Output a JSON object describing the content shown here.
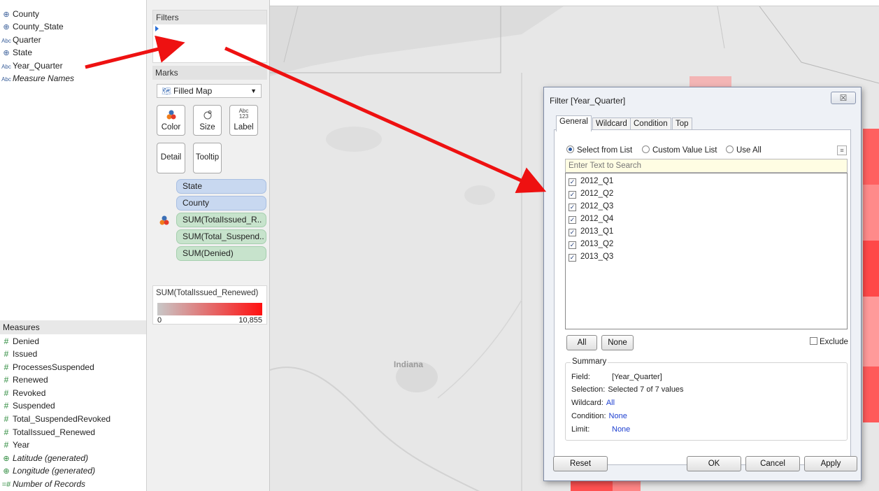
{
  "data_pane": {
    "dimensions": [
      {
        "icon": "globe-icon",
        "label": "County"
      },
      {
        "icon": "globe-icon",
        "label": "County_State"
      },
      {
        "icon": "abc-icon",
        "label": "Quarter"
      },
      {
        "icon": "globe-icon",
        "label": "State"
      },
      {
        "icon": "abc-icon",
        "label": "Year_Quarter"
      },
      {
        "icon": "abc-icon",
        "label": "Measure Names"
      }
    ],
    "measures_header": "Measures",
    "measures": [
      "Denied",
      "Issued",
      "ProcessesSuspended",
      "Renewed",
      "Revoked",
      "Suspended",
      "Total_SuspendedRevoked",
      "TotalIssued_Renewed",
      "Year",
      "Latitude (generated)",
      "Longitude (generated)",
      "Number of Records"
    ],
    "icon_glyphs": {
      "abc": "Abc",
      "hash": "#",
      "globe": "⊕",
      "calc_hash": "=#"
    }
  },
  "filters_card": {
    "title": "Filters"
  },
  "marks_card": {
    "title": "Marks",
    "mark_type": "Filled Map",
    "mark_type_icon": "filled-map-icon",
    "buttons": {
      "color": "Color",
      "size": "Size",
      "label": "Label",
      "detail": "Detail",
      "tooltip": "Tooltip"
    },
    "label_icon_text": "Abc\n123",
    "pills": [
      "State",
      "County",
      "SUM(TotalIssued_R..",
      "SUM(Total_Suspend..",
      "SUM(Denied)"
    ]
  },
  "legend": {
    "title": "SUM(TotalIssued_Renewed)",
    "min": "0",
    "max": "10,855",
    "colors": {
      "low": "#c8c8c8",
      "high": "#ff1010"
    }
  },
  "map": {
    "label": "Indiana"
  },
  "dialog": {
    "title": "Filter [Year_Quarter]",
    "close_glyph": "☒",
    "tabs": [
      "General",
      "Wildcard",
      "Condition",
      "Top"
    ],
    "radio": {
      "select_from_list": "Select from List",
      "custom_value_list": "Custom Value List",
      "use_all": "Use All",
      "selected": "Select from List"
    },
    "search_placeholder": "Enter Text to Search",
    "values": [
      "2012_Q1",
      "2012_Q2",
      "2012_Q3",
      "2012_Q4",
      "2013_Q1",
      "2013_Q2",
      "2013_Q3"
    ],
    "all_label": "All",
    "none_label": "None",
    "exclude_label": "Exclude",
    "summary": {
      "title": "Summary",
      "field_key": "Field:",
      "field_val": "[Year_Quarter]",
      "selection_key": "Selection:",
      "selection_val": "Selected 7 of 7 values",
      "wildcard_key": "Wildcard:",
      "wildcard_val": "All",
      "condition_key": "Condition:",
      "condition_val": "None",
      "limit_key": "Limit:",
      "limit_val": "None"
    },
    "reset_label": "Reset",
    "ok_label": "OK",
    "cancel_label": "Cancel",
    "apply_label": "Apply"
  },
  "colors": {
    "arrow": "#ee1111",
    "map_fill": "#ff4040",
    "dimension_pill": "#c8d8f0",
    "measure_pill": "#c7e3cc"
  }
}
